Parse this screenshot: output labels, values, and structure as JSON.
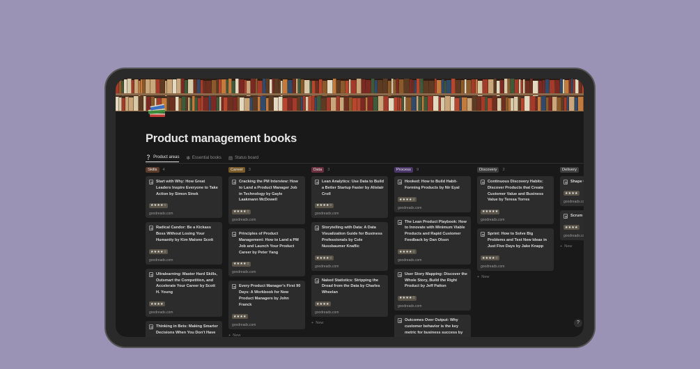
{
  "page": {
    "title": "Product management books",
    "emoji_name": "books-icon"
  },
  "tabs": [
    {
      "label": "Product areas",
      "icon": "❔"
    },
    {
      "label": "Essential books",
      "icon": "❇"
    },
    {
      "label": "Status board",
      "icon": "▤"
    }
  ],
  "colors": {
    "Skills": "#5b3a2a",
    "Career": "#7a5a28",
    "Data": "#6b2e3e",
    "Process": "#4a3569",
    "Discovery": "#3b3b3b",
    "Delivery": "#3e3e3e"
  },
  "columns": [
    {
      "name": "Skills",
      "count": "4",
      "cards": [
        {
          "title": "Start with Why: How Great Leaders Inspire Everyone to Take Action by Simon Sinek",
          "stars": "★★★★☆",
          "source": "goodreads.com"
        },
        {
          "title": "Radical Candor: Be a Kickass Boss Without Losing Your Humanity by Kim Malone Scott",
          "stars": "★★★★☆",
          "source": "goodreads.com"
        },
        {
          "title": "Ultralearning: Master Hard Skills, Outsmart the Competition, and Accelerate Your Career by Scott H. Young",
          "stars": "★★★★",
          "source": "goodreads.com"
        },
        {
          "title": "Thinking in Bets: Making Smarter Decisions When You Don't Have All the Facts by",
          "stars": "",
          "source": ""
        }
      ],
      "new": ""
    },
    {
      "name": "Career",
      "count": "3",
      "cards": [
        {
          "title": "Cracking the PM Interview: How to Land a Product Manager Job in Technology by Gayle Laakmann McDowell",
          "stars": "★★★★☆",
          "source": "goodreads.com"
        },
        {
          "title": "Principles of Product Management: How to Land a PM Job and Launch Your Product Career by Peter Yang",
          "stars": "★★★★☆",
          "source": "goodreads.com"
        },
        {
          "title": "Every Product Manager's First 90 Days: A Workbook for New Product Managers by John Franck",
          "stars": "★★★★",
          "source": "goodreads.com"
        }
      ],
      "new": "New"
    },
    {
      "name": "Data",
      "count": "3",
      "cards": [
        {
          "title": "Lean Analytics: Use Data to Build a Better Startup Faster by Alistair Croll",
          "stars": "★★★★☆",
          "source": "goodreads.com"
        },
        {
          "title": "Storytelling with Data: A Data Visualization Guide for Business Professionals by Cole Nussbaumer Knaflic",
          "stars": "★★★★☆",
          "source": "goodreads.com"
        },
        {
          "title": "Naked Statistics: Stripping the Dread from the Data by Charles Wheelan",
          "stars": "★★★★",
          "source": "goodreads.com"
        }
      ],
      "new": "New"
    },
    {
      "name": "Process",
      "count": "9",
      "cards": [
        {
          "title": "Hooked: How to Build Habit-Forming Products by Nir Eyal",
          "stars": "★★★★☆",
          "source": "goodreads.com"
        },
        {
          "title": "The Lean Product Playbook: How to Innovate with Minimum Viable Products and Rapid Customer Feedback by Dan Olsen",
          "stars": "★★★★☆",
          "source": "goodreads.com"
        },
        {
          "title": "User Story Mapping: Discover the Whole Story, Build the Right Product by Jeff Patton",
          "stars": "★★★★☆",
          "source": "goodreads.com"
        },
        {
          "title": "Outcomes Over Output: Why customer behavior is the key metric for business success by",
          "stars": "",
          "source": ""
        }
      ],
      "new": ""
    },
    {
      "name": "Discovery",
      "count": "2",
      "cards": [
        {
          "title": "Continuous Discovery Habits: Discover Products that Create Customer Value and Business Value by Teresa Torres",
          "stars": "★★★★★",
          "source": "goodreads.com"
        },
        {
          "title": "Sprint: How to Solve Big Problems and Test New Ideas in Just Five Days by Jake Knapp",
          "stars": "★★★★☆",
          "source": "goodreads.com"
        }
      ],
      "new": "New"
    },
    {
      "name": "Delivery",
      "count": "",
      "cards": [
        {
          "title": "Shape Circles Matter",
          "stars": "★★★★",
          "source": "goodreads.com"
        },
        {
          "title": "Scrum the W Jeff S",
          "stars": "★★★★",
          "source": "goodreads.com"
        }
      ],
      "new": "New"
    }
  ],
  "help": "?"
}
